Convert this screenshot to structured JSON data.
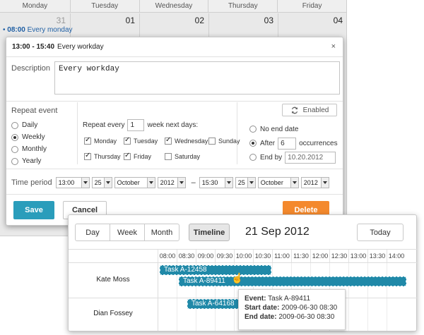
{
  "calendar": {
    "days": [
      "Monday",
      "Tuesday",
      "Wednesday",
      "Thursday",
      "Friday"
    ],
    "dates": [
      "31",
      "01",
      "02",
      "03",
      "04"
    ],
    "event": {
      "time": "08:00",
      "text": "Every monday"
    }
  },
  "lightbox": {
    "title_time": "13:00 - 15:40",
    "title_text": "Every workday",
    "close": "×",
    "description_label": "Description",
    "description_value": "Every workday",
    "repeat_label": "Repeat event",
    "repeat_options": [
      "Daily",
      "Weekly",
      "Monthly",
      "Yearly"
    ],
    "repeat_selected": "Weekly",
    "repeat_every_prefix": "Repeat every",
    "repeat_every_value": "1",
    "repeat_every_suffix": "week next days:",
    "weekdays": [
      {
        "label": "Monday",
        "checked": true
      },
      {
        "label": "Tuesday",
        "checked": true
      },
      {
        "label": "Wednesday",
        "checked": true
      },
      {
        "label": "Sunday",
        "checked": false
      },
      {
        "label": "Thursday",
        "checked": true
      },
      {
        "label": "Friday",
        "checked": true
      },
      {
        "label": "Saturday",
        "checked": false
      }
    ],
    "enabled_label": "Enabled",
    "end_options": {
      "no_end": "No end date",
      "after": "After",
      "after_value": "6",
      "occurrences": "occurrences",
      "end_by": "End by",
      "end_by_value": "10.20.2012"
    },
    "end_selected": "after",
    "time_period_label": "Time period",
    "start": {
      "hour": "13:00",
      "day": "25",
      "month": "October",
      "year": "2012"
    },
    "end": {
      "hour": "15:30",
      "day": "25",
      "month": "October",
      "year": "2012"
    },
    "dash": "–",
    "save": "Save",
    "cancel": "Cancel",
    "delete": "Delete"
  },
  "timeline": {
    "views": [
      "Day",
      "Week",
      "Month"
    ],
    "timeline_label": "Timeline",
    "date": "21 Sep 2012",
    "today": "Today",
    "hours": [
      "08:00",
      "08:30",
      "09:00",
      "09:30",
      "10:00",
      "10:30",
      "11:00",
      "11:30",
      "12:00",
      "12:30",
      "13:00",
      "13:30",
      "14:00"
    ],
    "people": [
      "Kate Moss",
      "Dian Fossey"
    ],
    "tasks": [
      "Task A-12458",
      "Task A-89411",
      "Task A-64168"
    ],
    "tooltip": {
      "event_label": "Event:",
      "event_value": "Task A-89411",
      "start_label": "Start date:",
      "start_value": "2009-06-30 08:30",
      "end_label": "End date:",
      "end_value": "2009-06-30 08:30"
    }
  },
  "colors": {
    "accent": "#2a9dbb",
    "task": "#2089a8",
    "delete": "#f4892d",
    "event_text": "#1f5fa4"
  }
}
